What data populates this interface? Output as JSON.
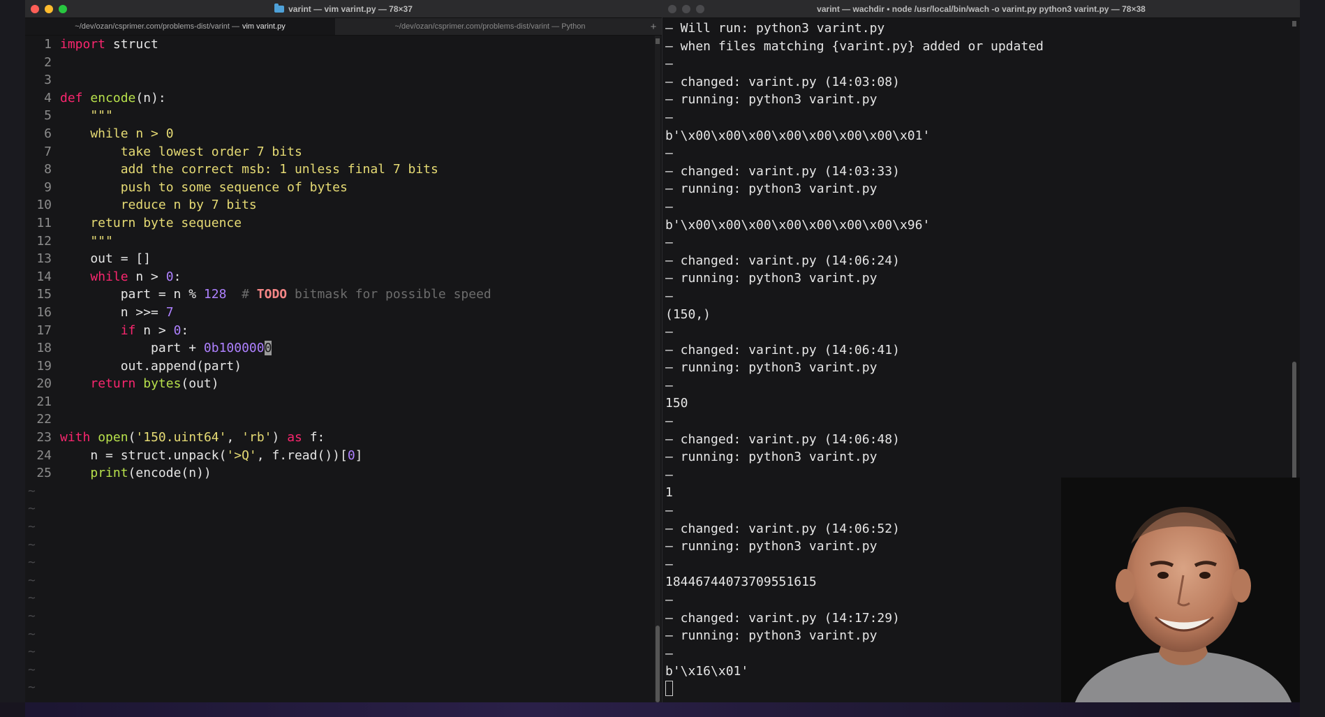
{
  "left_window": {
    "title": "varint — vim varint.py — 78×37",
    "tabs": [
      {
        "path": "~/dev/ozan/csprimer.com/problems-dist/varint — ",
        "cmd": "vim varint.py"
      },
      {
        "path": "~/dev/ozan/csprimer.com/problems-dist/varint — Python",
        "cmd": ""
      }
    ],
    "tab_plus": "+",
    "code_lines": [
      [
        {
          "t": "kw",
          "s": "import"
        },
        {
          "t": "",
          "s": " struct"
        }
      ],
      [],
      [],
      [
        {
          "t": "kw",
          "s": "def"
        },
        {
          "t": "",
          "s": " "
        },
        {
          "t": "fn",
          "s": "encode"
        },
        {
          "t": "",
          "s": "(n):"
        }
      ],
      [
        {
          "t": "str",
          "s": "    \"\"\""
        }
      ],
      [
        {
          "t": "str",
          "s": "    while n > 0"
        }
      ],
      [
        {
          "t": "str",
          "s": "        take lowest order 7 bits"
        }
      ],
      [
        {
          "t": "str",
          "s": "        add the correct msb: 1 unless final 7 bits"
        }
      ],
      [
        {
          "t": "str",
          "s": "        push to some sequence of bytes"
        }
      ],
      [
        {
          "t": "str",
          "s": "        reduce n by 7 bits"
        }
      ],
      [
        {
          "t": "str",
          "s": "    return byte sequence"
        }
      ],
      [
        {
          "t": "str",
          "s": "    \"\"\""
        }
      ],
      [
        {
          "t": "",
          "s": "    out = []"
        }
      ],
      [
        {
          "t": "",
          "s": "    "
        },
        {
          "t": "kw",
          "s": "while"
        },
        {
          "t": "",
          "s": " n > "
        },
        {
          "t": "num",
          "s": "0"
        },
        {
          "t": "",
          "s": ":"
        }
      ],
      [
        {
          "t": "",
          "s": "        part = n % "
        },
        {
          "t": "num",
          "s": "128"
        },
        {
          "t": "",
          "s": "  "
        },
        {
          "t": "cmt",
          "s": "# "
        },
        {
          "t": "todo",
          "s": "TODO"
        },
        {
          "t": "cmt",
          "s": " bitmask for possible speed"
        }
      ],
      [
        {
          "t": "",
          "s": "        n >>= "
        },
        {
          "t": "num",
          "s": "7"
        }
      ],
      [
        {
          "t": "",
          "s": "        "
        },
        {
          "t": "kw",
          "s": "if"
        },
        {
          "t": "",
          "s": " n > "
        },
        {
          "t": "num",
          "s": "0"
        },
        {
          "t": "",
          "s": ":"
        }
      ],
      [
        {
          "t": "",
          "s": "            part + "
        },
        {
          "t": "num",
          "s": "0b100000"
        },
        {
          "t": "cursor",
          "s": "0"
        }
      ],
      [
        {
          "t": "",
          "s": "        out.append(part)"
        }
      ],
      [
        {
          "t": "",
          "s": "    "
        },
        {
          "t": "kw",
          "s": "return"
        },
        {
          "t": "",
          "s": " "
        },
        {
          "t": "fn",
          "s": "bytes"
        },
        {
          "t": "",
          "s": "(out)"
        }
      ],
      [],
      [],
      [
        {
          "t": "kw",
          "s": "with"
        },
        {
          "t": "",
          "s": " "
        },
        {
          "t": "fn",
          "s": "open"
        },
        {
          "t": "",
          "s": "("
        },
        {
          "t": "str",
          "s": "'150.uint64'"
        },
        {
          "t": "",
          "s": ", "
        },
        {
          "t": "str",
          "s": "'rb'"
        },
        {
          "t": "",
          "s": ") "
        },
        {
          "t": "kw",
          "s": "as"
        },
        {
          "t": "",
          "s": " f:"
        }
      ],
      [
        {
          "t": "",
          "s": "    n = struct.unpack("
        },
        {
          "t": "str",
          "s": "'>Q'"
        },
        {
          "t": "",
          "s": ", f.read())["
        },
        {
          "t": "num",
          "s": "0"
        },
        {
          "t": "",
          "s": "]"
        }
      ],
      [
        {
          "t": "",
          "s": "    "
        },
        {
          "t": "fn",
          "s": "print"
        },
        {
          "t": "",
          "s": "(encode(n))"
        }
      ]
    ],
    "tilde_count": 12,
    "tilde_char": "~"
  },
  "right_window": {
    "title": "varint — wachdir • node /usr/local/bin/wach -o varint.py python3 varint.py — 78×38",
    "terminal_lines": [
      "– Will run: python3 varint.py",
      "– when files matching {varint.py} added or updated",
      "–",
      "– changed: varint.py (14:03:08)",
      "– running: python3 varint.py",
      "–",
      "b'\\x00\\x00\\x00\\x00\\x00\\x00\\x00\\x01'",
      "–",
      "– changed: varint.py (14:03:33)",
      "– running: python3 varint.py",
      "–",
      "b'\\x00\\x00\\x00\\x00\\x00\\x00\\x00\\x96'",
      "–",
      "– changed: varint.py (14:06:24)",
      "– running: python3 varint.py",
      "–",
      "(150,)",
      "–",
      "– changed: varint.py (14:06:41)",
      "– running: python3 varint.py",
      "–",
      "150",
      "–",
      "– changed: varint.py (14:06:48)",
      "– running: python3 varint.py",
      "–",
      "1",
      "–",
      "– changed: varint.py (14:06:52)",
      "– running: python3 varint.py",
      "–",
      "18446744073709551615",
      "–",
      "– changed: varint.py (14:17:29)",
      "– running: python3 varint.py",
      "–",
      "b'\\x16\\x01'"
    ]
  },
  "colors": {
    "keyword": "#f9266e",
    "function": "#b7e04b",
    "string": "#e6db74",
    "number": "#ae81ff",
    "comment": "#6c6c6c"
  }
}
